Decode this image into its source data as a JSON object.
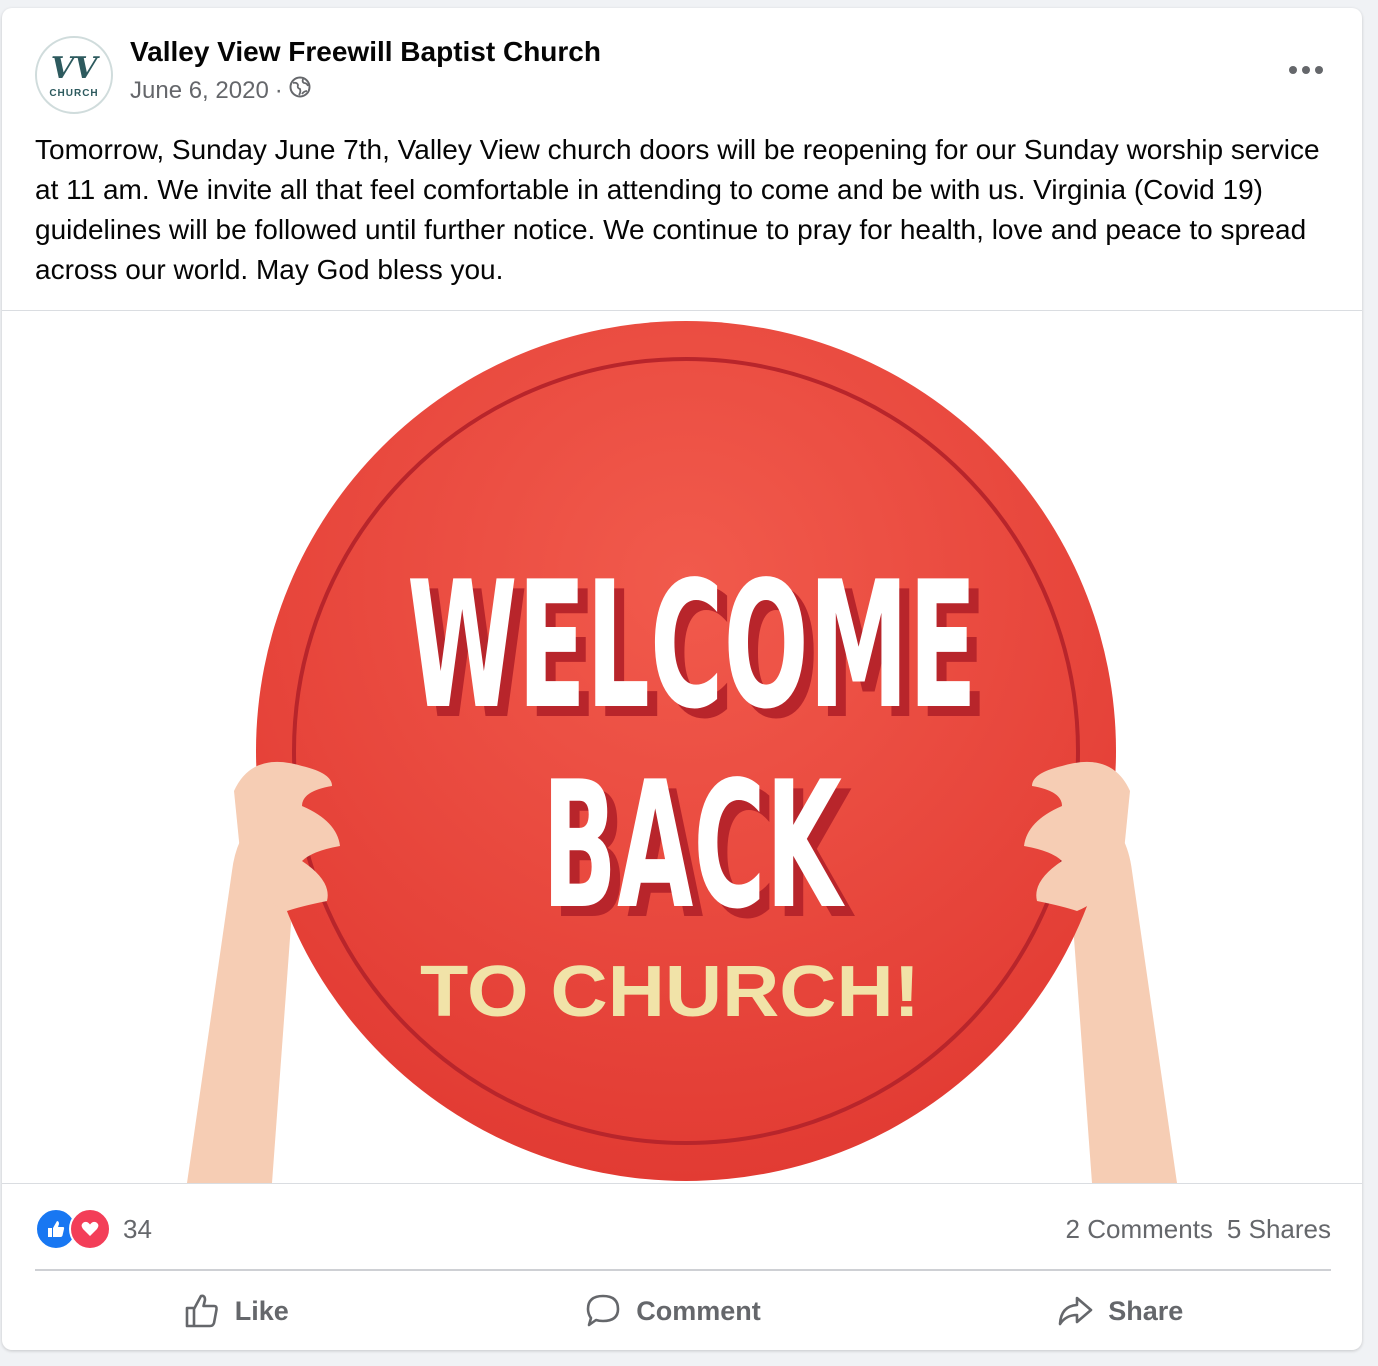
{
  "post": {
    "page_name": "Valley View Freewill Baptist Church",
    "date": "June 6, 2020",
    "separator": "·",
    "privacy_icon": "globe-icon",
    "more_icon": "more-options-icon",
    "avatar": {
      "monogram": "VV",
      "caption": "CHURCH"
    },
    "text": "Tomorrow, Sunday June 7th, Valley View church doors will be reopening for our Sunday worship service at 11 am. We invite all that feel comfortable in attending to come and be with us. Virginia (Covid 19) guidelines will be followed until further notice. We continue to pray for health, love and peace to spread across our world. May God bless you.",
    "image": {
      "line1": "WELCOME",
      "line2": "BACK",
      "line3": "TO CHURCH!",
      "colors": {
        "sign": "#e8413a",
        "sign_dark": "#b8252b",
        "headline": "#ffffff",
        "subline": "#f1e3a8",
        "skin": "#f6cdb4"
      }
    }
  },
  "stats": {
    "reaction_icons": [
      "like-reaction-icon",
      "love-reaction-icon"
    ],
    "reaction_count": "34",
    "comments": "2 Comments",
    "shares": "5 Shares"
  },
  "actions": {
    "like": "Like",
    "comment": "Comment",
    "share": "Share"
  },
  "colors": {
    "like_blue": "#1877f2",
    "love_red": "#f33e58",
    "muted": "#65676b"
  }
}
